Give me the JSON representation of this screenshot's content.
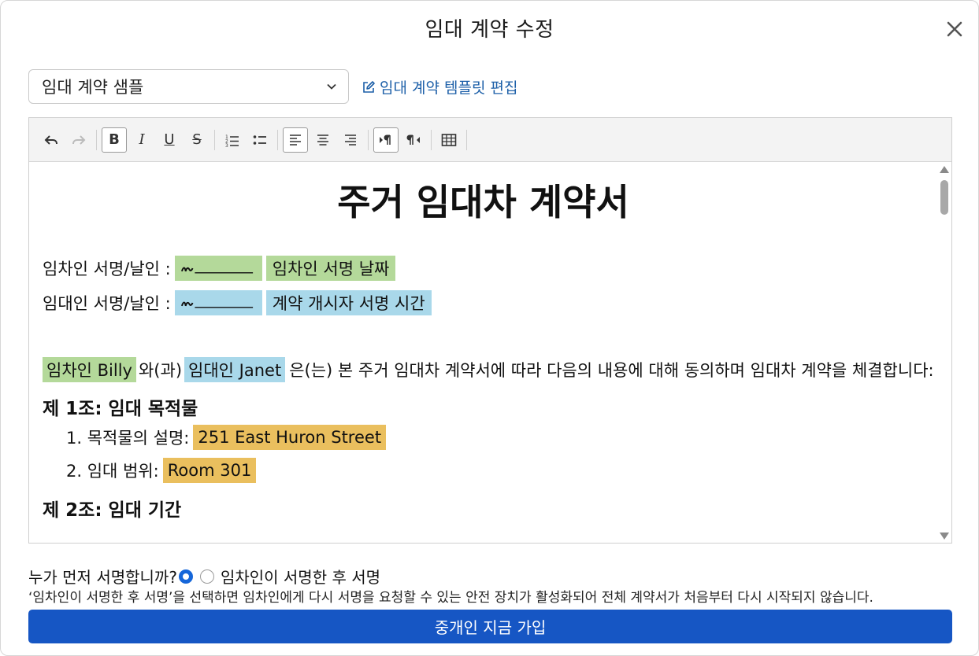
{
  "modal": {
    "title": "임대 계약 수정",
    "close_icon": "close-icon"
  },
  "template": {
    "selected": "임대 계약 샘플",
    "edit_link": "임대 계약 템플릿 편집"
  },
  "toolbar": {
    "buttons": [
      "undo-icon",
      "redo-icon",
      "bold-icon",
      "italic-icon",
      "underline-icon",
      "strikethrough-icon",
      "ordered-list-icon",
      "bullet-list-icon",
      "align-left-icon",
      "align-center-icon",
      "align-right-icon",
      "ltr-icon",
      "rtl-icon",
      "table-icon"
    ],
    "bold": "B",
    "italic": "I",
    "underline": "U",
    "strike": "S"
  },
  "document": {
    "title": "주거 임대차 계약서",
    "tenant_sig_label": "임차인 서명/날인 :",
    "tenant_sig_date": "임차인 서명 날짜",
    "landlord_sig_label": "임대인 서명/날인 :",
    "landlord_sig_time": "계약 개시자 서명 시간",
    "tenant_tag": "임차인 Billy",
    "and_text": "와(과)",
    "landlord_tag": "임대인 Janet",
    "intro_text": "은(는) 본 주거 임대차 계약서에 따라 다음의 내용에 대해 동의하며 임대차 계약을 체결합니다:",
    "article1": "제 1조: 임대 목적물",
    "item1_label": "1. 목적물의 설명:",
    "item1_value": "251 East Huron Street",
    "item2_label": "2. 임대 범위:",
    "item2_value": "Room 301",
    "article2": "제 2조: 임대 기간"
  },
  "signing": {
    "question": "누가 먼저 서명합니까?",
    "option_label": "임차인이 서명한 후 서명",
    "help": "‘임차인이 서명한 후 서명’을 선택하면 임차인에게 다시 서명을 요청할 수 있는 안전 장치가 활성화되어 전체 계약서가 처음부터 다시 시작되지 않습니다."
  },
  "cta": {
    "label": "중개인 지금 가입"
  },
  "colors": {
    "tenant_field": "#b4d99a",
    "landlord_field": "#a9d8ea",
    "property_field": "#eabf5e",
    "primary": "#1656c4",
    "link": "#1c5fa8"
  }
}
